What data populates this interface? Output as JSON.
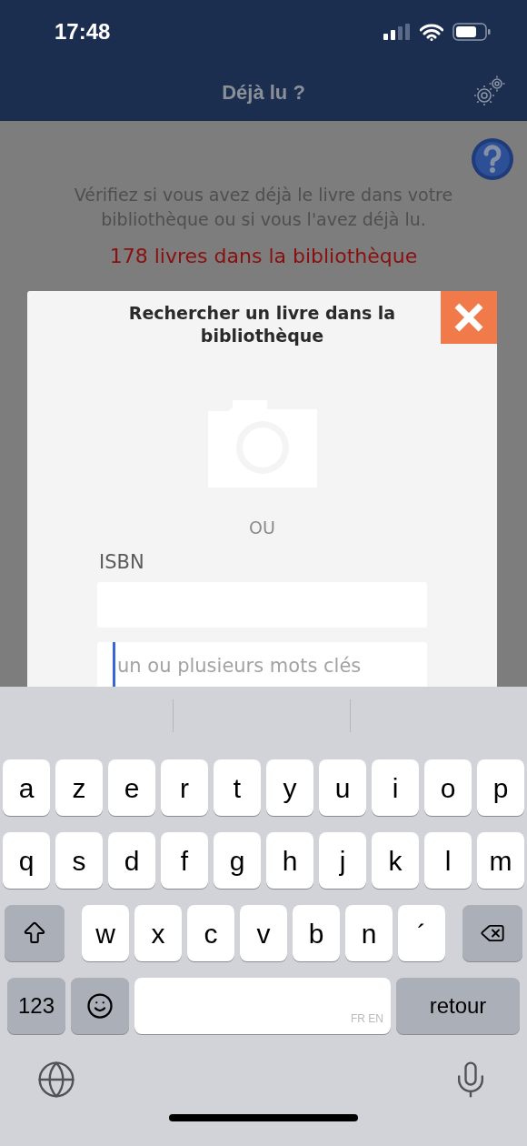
{
  "status_bar": {
    "time": "17:48"
  },
  "nav_bar": {
    "title": "Déjà lu ?"
  },
  "intro": {
    "text": "Vérifiez si vous avez déjà le livre dans votre bibliothèque ou si vous l'avez déjà lu.",
    "count": "178 livres dans la bibliothèque"
  },
  "dialog": {
    "title": "Rechercher un livre dans la bibliothèque",
    "separator": "OU",
    "isbn_label": "ISBN",
    "keywords_placeholder": "un ou plusieurs mots clés"
  },
  "keyboard": {
    "rows": [
      {
        "keys": [
          {
            "kind": "letter",
            "label": "a"
          },
          {
            "kind": "letter",
            "label": "z"
          },
          {
            "kind": "letter",
            "label": "e"
          },
          {
            "kind": "letter",
            "label": "r"
          },
          {
            "kind": "letter",
            "label": "t"
          },
          {
            "kind": "letter",
            "label": "y"
          },
          {
            "kind": "letter",
            "label": "u"
          },
          {
            "kind": "letter",
            "label": "i"
          },
          {
            "kind": "letter",
            "label": "o"
          },
          {
            "kind": "letter",
            "label": "p"
          }
        ]
      },
      {
        "keys": [
          {
            "kind": "letter",
            "label": "q"
          },
          {
            "kind": "letter",
            "label": "s"
          },
          {
            "kind": "letter",
            "label": "d"
          },
          {
            "kind": "letter",
            "label": "f"
          },
          {
            "kind": "letter",
            "label": "g"
          },
          {
            "kind": "letter",
            "label": "h"
          },
          {
            "kind": "letter",
            "label": "j"
          },
          {
            "kind": "letter",
            "label": "k"
          },
          {
            "kind": "letter",
            "label": "l"
          },
          {
            "kind": "letter",
            "label": "m"
          }
        ]
      },
      {
        "keys": [
          {
            "kind": "shift"
          },
          {
            "kind": "letter",
            "label": "w"
          },
          {
            "kind": "letter",
            "label": "x"
          },
          {
            "kind": "letter",
            "label": "c"
          },
          {
            "kind": "letter",
            "label": "v"
          },
          {
            "kind": "letter",
            "label": "b"
          },
          {
            "kind": "letter",
            "label": "n"
          },
          {
            "kind": "letter",
            "label": "´"
          },
          {
            "kind": "delete"
          }
        ]
      },
      {
        "keys": [
          {
            "kind": "function",
            "label": "123"
          },
          {
            "kind": "emoji"
          },
          {
            "kind": "space",
            "label": "FR EN"
          },
          {
            "kind": "function",
            "label": "retour"
          }
        ]
      }
    ]
  }
}
